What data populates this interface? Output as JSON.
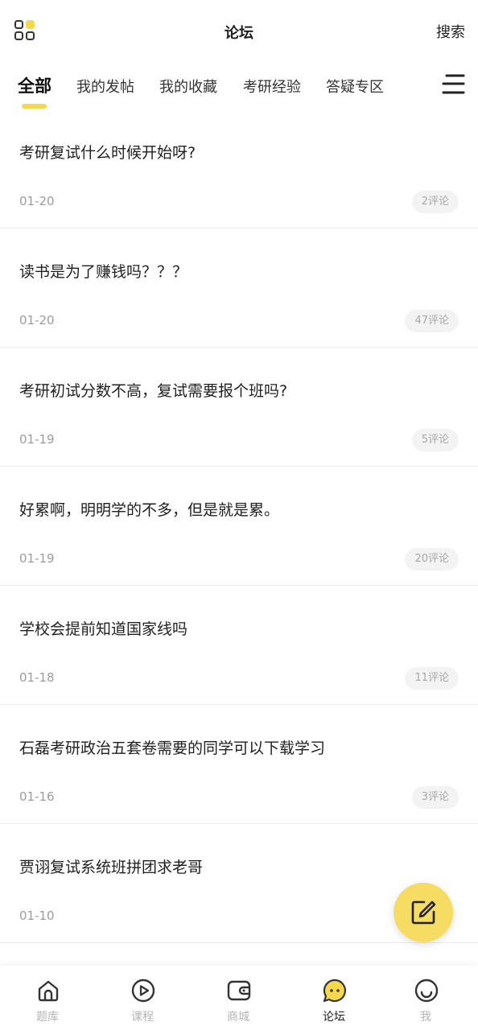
{
  "header": {
    "title": "论坛",
    "search_label": "搜索"
  },
  "tabs": [
    {
      "label": "全部",
      "active": true
    },
    {
      "label": "我的发帖",
      "active": false
    },
    {
      "label": "我的收藏",
      "active": false
    },
    {
      "label": "考研经验",
      "active": false
    },
    {
      "label": "答疑专区",
      "active": false
    }
  ],
  "posts": [
    {
      "title": "考研复试什么时候开始呀?",
      "date": "01-20",
      "comments": "2评论"
    },
    {
      "title": "读书是为了赚钱吗？？？",
      "date": "01-20",
      "comments": "47评论"
    },
    {
      "title": "考研初试分数不高，复试需要报个班吗?",
      "date": "01-19",
      "comments": "5评论"
    },
    {
      "title": "好累啊，明明学的不多，但是就是累。",
      "date": "01-19",
      "comments": "20评论"
    },
    {
      "title": "学校会提前知道国家线吗",
      "date": "01-18",
      "comments": "11评论"
    },
    {
      "title": "石磊考研政治五套卷需要的同学可以下载学习",
      "date": "01-16",
      "comments": "3评论"
    },
    {
      "title": "贾诩复试系统班拼团求老哥",
      "date": "01-10",
      "comments": ""
    }
  ],
  "nav": [
    {
      "label": "题库",
      "icon": "home-icon",
      "active": false
    },
    {
      "label": "课程",
      "icon": "play-circle-icon",
      "active": false
    },
    {
      "label": "商城",
      "icon": "wallet-icon",
      "active": false
    },
    {
      "label": "论坛",
      "icon": "chat-bubble-icon",
      "active": true
    },
    {
      "label": "我",
      "icon": "smiley-icon",
      "active": false
    }
  ],
  "colors": {
    "accent": "#f6d84b",
    "fab": "#f6dc62",
    "nav_inactive": "#b4b4b4",
    "badge_bg": "#f3f3f3"
  }
}
